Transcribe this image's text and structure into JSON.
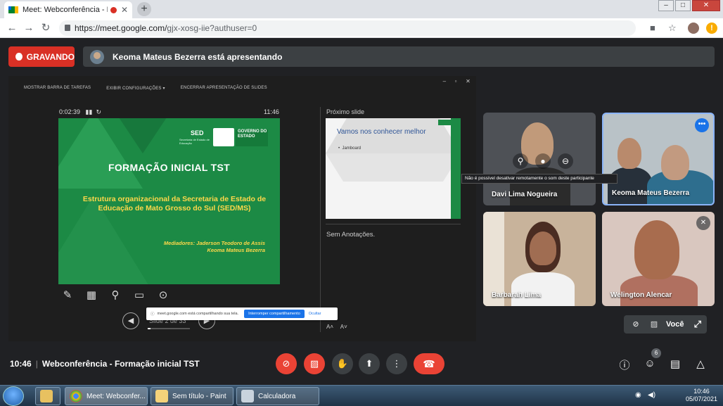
{
  "browser": {
    "tab_title": "Meet: Webconferência - For",
    "new_tab": "+",
    "close_tab": "✕",
    "url_host": "https://meet.google.com/",
    "url_path": "gjx-xosg-iie?authuser=0",
    "window_controls": [
      "–",
      "□",
      "✕"
    ]
  },
  "header": {
    "recording_label": "GRAVANDO",
    "presenter_text": "Keoma Mateus Bezerra está apresentando"
  },
  "presenter_view": {
    "toolbar": [
      "MOSTRAR BARRA DE TAREFAS",
      "EXIBIR CONFIGURAÇÕES ▾",
      "ENCERRAR APRESENTAÇÃO DE SLIDES"
    ],
    "elapsed": "0:02:39",
    "clock": "11:46",
    "slide": {
      "logo_text": "SED",
      "logo_sub": "Secretaria de Estado de Educação",
      "gov_text": "GOVERNO DO ESTADO",
      "title": "FORMAÇÃO INICIAL TST",
      "subtitle": "Estrutura organizacional da Secretaria de Estado de Educação de Mato Grosso do Sul (SED/MS)",
      "mediators": "Mediadores: Jaderson Teodoro de Assis",
      "mediator2": "Keoma Mateus Bezerra"
    },
    "next_label": "Próximo slide",
    "next_slide_title": "Vamos nos conhecer melhor",
    "next_slide_bullet": "Jamboard",
    "notes": "Sem Anotações.",
    "slide_counter": "Slide 2 de 33",
    "progress": 0.06,
    "font_controls": "A˄ A˅"
  },
  "share_banner": {
    "text": "meet.google.com está compartilhando sua tela.",
    "stop_label": "Interromper compartilhamento",
    "hide_label": "Ocultar"
  },
  "participants": [
    {
      "name": "Davi Lima Nogueira"
    },
    {
      "name": "Keoma Mateus Bezerra"
    },
    {
      "name": "Barbarah Lima"
    },
    {
      "name": "Welington Alencar"
    }
  ],
  "tooltip": "Não é possível desativar remotamente o som deste participante",
  "self_view": {
    "label": "Você"
  },
  "bottom": {
    "time": "10:46",
    "meeting_title": "Webconferência - Formação inicial TST",
    "participant_count": "6"
  },
  "taskbar": {
    "items": [
      "Meet: Webconfer...",
      "Sem título - Paint",
      "Calculadora"
    ],
    "time": "10:46",
    "date": "05/07/2021"
  },
  "colors": {
    "recording_red": "#d93025",
    "slide_green": "#1c8a45",
    "accent_blue": "#1a73e8"
  }
}
